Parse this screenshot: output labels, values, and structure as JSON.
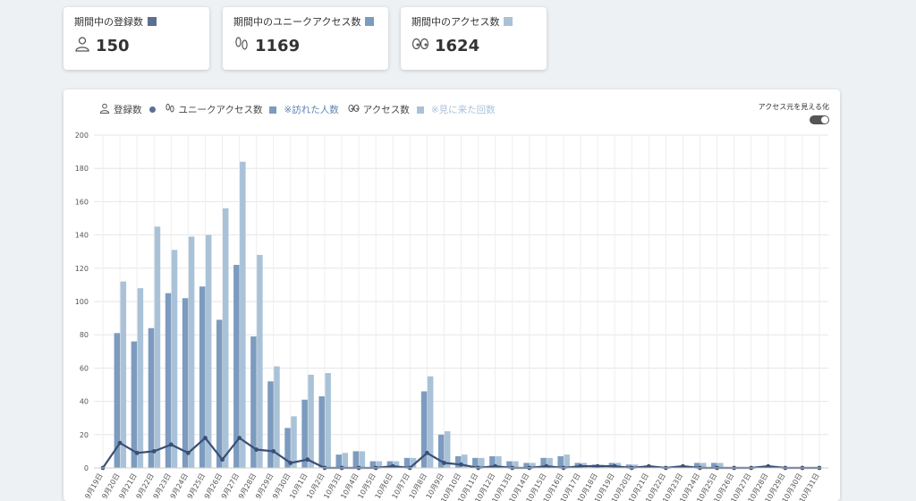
{
  "stats": [
    {
      "title": "期間中の登録数",
      "value": "150",
      "color": "#5a6f93",
      "icon": "person-icon"
    },
    {
      "title": "期間中のユニークアクセス数",
      "value": "1169",
      "color": "#7c9bbf",
      "icon": "footprints-icon"
    },
    {
      "title": "期間中のアクセス数",
      "value": "1624",
      "color": "#a9c2d8",
      "icon": "eyes-icon"
    }
  ],
  "legend": {
    "registrations": "登録数",
    "unique": "ユニークアクセス数",
    "unique_note": "※訪れた人数",
    "access": "アクセス数",
    "access_note": "※見に来た回数"
  },
  "toggle": {
    "label": "アクセス元を見える化",
    "state": "on"
  },
  "colors": {
    "line": "#3b4f74",
    "unique_bar": "#7c9bbf",
    "access_bar": "#a9c2d8"
  },
  "chart_data": {
    "type": "bar",
    "categories": [
      "9月19日",
      "9月20日",
      "9月21日",
      "9月22日",
      "9月23日",
      "9月24日",
      "9月25日",
      "9月26日",
      "9月27日",
      "9月28日",
      "9月29日",
      "9月30日",
      "10月1日",
      "10月2日",
      "10月3日",
      "10月4日",
      "10月5日",
      "10月6日",
      "10月7日",
      "10月8日",
      "10月9日",
      "10月10日",
      "10月11日",
      "10月12日",
      "10月13日",
      "10月14日",
      "10月15日",
      "10月16日",
      "10月17日",
      "10月18日",
      "10月19日",
      "10月20日",
      "10月21日",
      "10月22日",
      "10月23日",
      "10月24日",
      "10月25日",
      "10月26日",
      "10月27日",
      "10月28日",
      "10月29日",
      "10月30日",
      "10月31日"
    ],
    "series": [
      {
        "name": "ユニークアクセス数",
        "type": "bar",
        "values": [
          0,
          81,
          76,
          84,
          105,
          102,
          109,
          89,
          122,
          79,
          52,
          24,
          41,
          43,
          8,
          10,
          4,
          4,
          6,
          46,
          20,
          7,
          6,
          7,
          4,
          3,
          6,
          7,
          3,
          2,
          3,
          2,
          1,
          0,
          1,
          3,
          3,
          0,
          0,
          1,
          0,
          0,
          0
        ]
      },
      {
        "name": "アクセス数",
        "type": "bar",
        "values": [
          0,
          112,
          108,
          145,
          131,
          139,
          140,
          156,
          184,
          128,
          61,
          31,
          56,
          57,
          9,
          10,
          4,
          4,
          6,
          55,
          22,
          8,
          6,
          7,
          4,
          3,
          6,
          8,
          3,
          2,
          3,
          2,
          1,
          0,
          1,
          3,
          3,
          0,
          0,
          1,
          0,
          0,
          0
        ]
      },
      {
        "name": "登録数",
        "type": "line",
        "values": [
          0,
          15,
          9,
          10,
          14,
          9,
          18,
          5,
          18,
          11,
          10,
          3,
          5,
          0,
          0,
          0,
          0,
          1,
          0,
          9,
          3,
          2,
          0,
          1,
          0,
          0,
          1,
          0,
          1,
          1,
          1,
          0,
          1,
          0,
          1,
          0,
          0,
          0,
          0,
          1,
          0,
          0,
          0
        ]
      }
    ],
    "y_ticks": [
      "200",
      "180",
      "160",
      "140",
      "120",
      "100",
      "80",
      "60",
      "40",
      "20",
      "0"
    ],
    "ylim": [
      0,
      200
    ],
    "grid": true
  }
}
